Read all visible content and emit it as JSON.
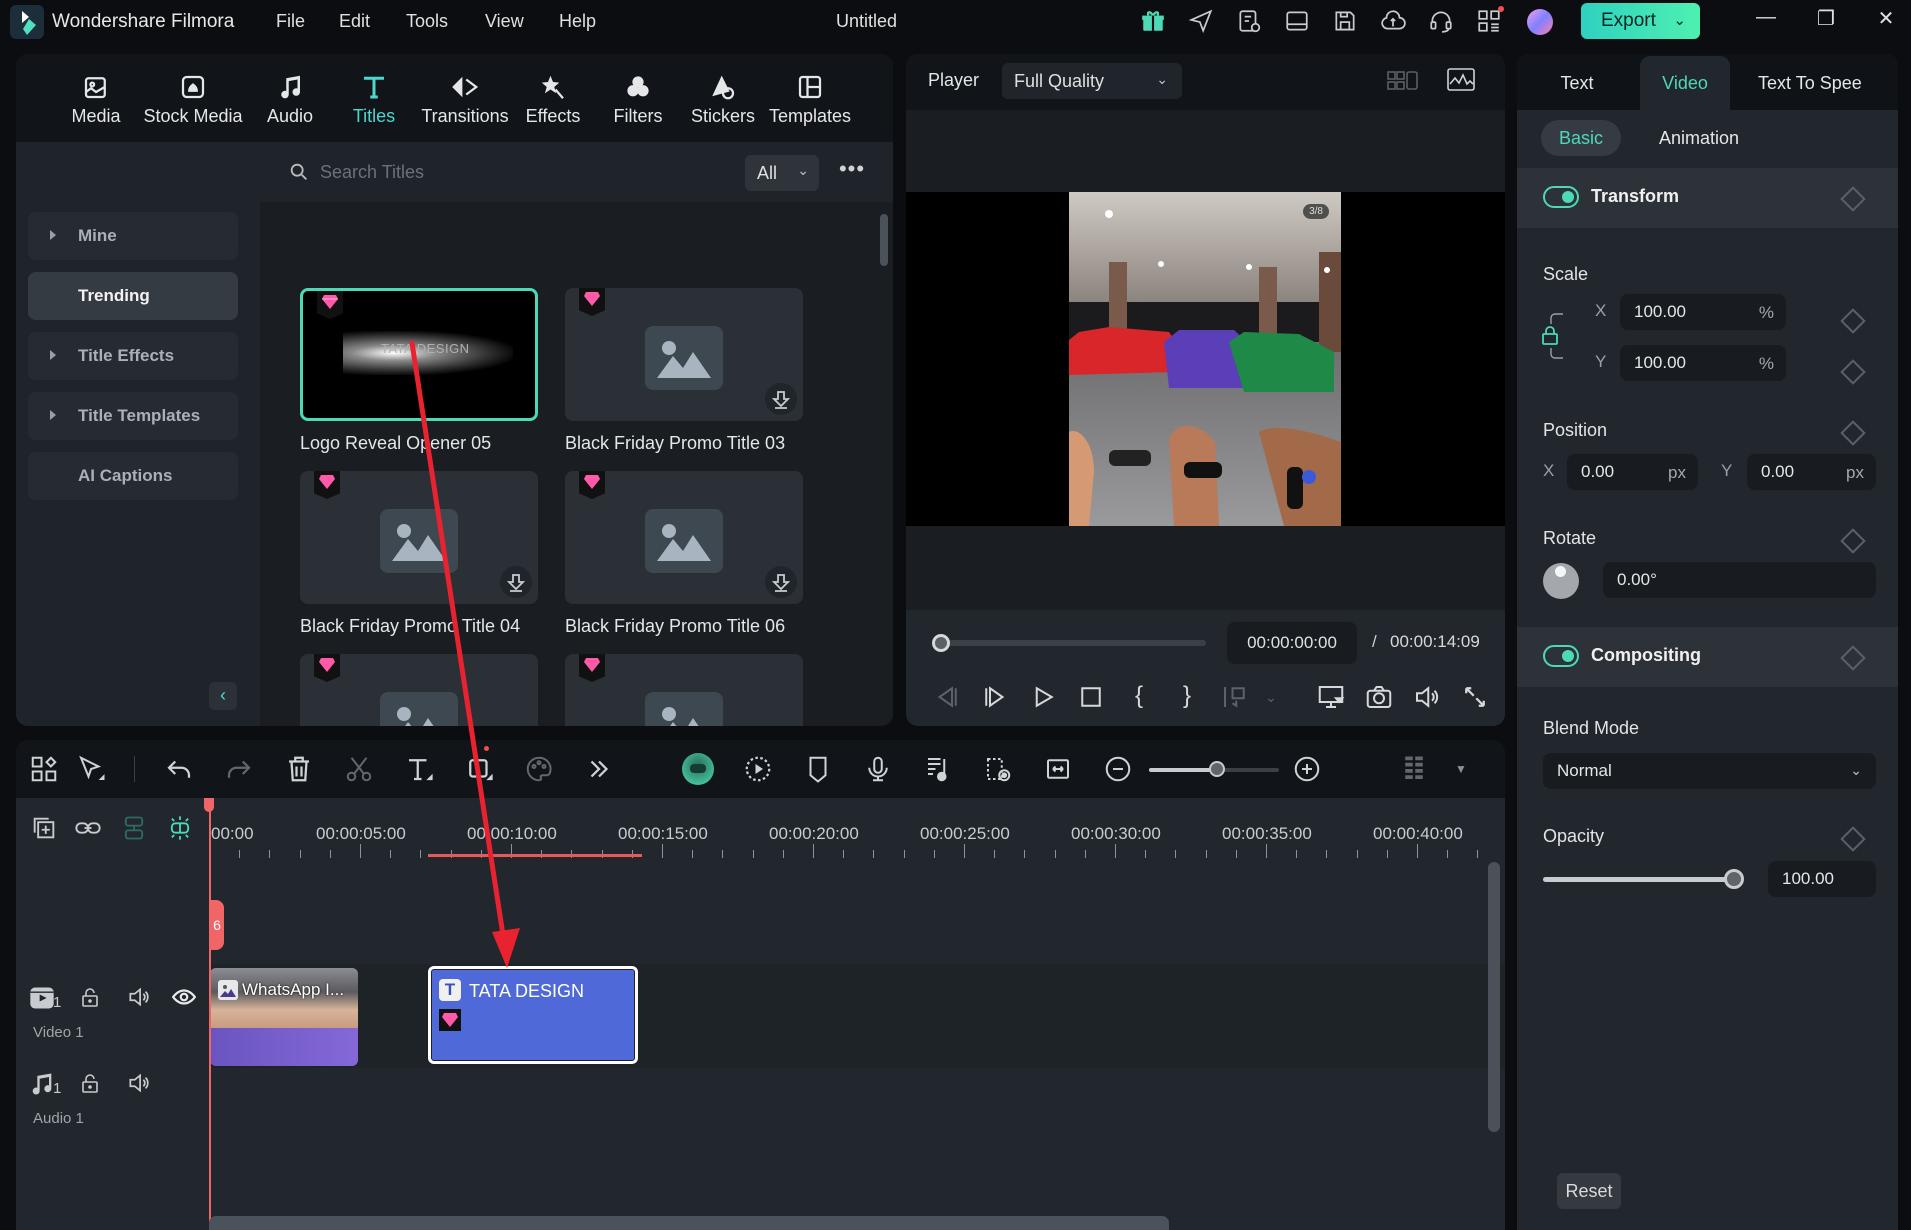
{
  "app": {
    "name": "Wondershare Filmora",
    "document_title": "Untitled",
    "menu": [
      "File",
      "Edit",
      "Tools",
      "View",
      "Help"
    ],
    "toolbar_icons": [
      "gift-icon",
      "send-icon",
      "task-list-icon",
      "layout-icon",
      "save-icon",
      "cloud-icon",
      "headset-icon",
      "apps-icon",
      "avatar"
    ],
    "export_label": "Export"
  },
  "library": {
    "tabs": [
      {
        "label": "Media",
        "icon": "media-icon"
      },
      {
        "label": "Stock Media",
        "icon": "stock-media-icon"
      },
      {
        "label": "Audio",
        "icon": "audio-icon"
      },
      {
        "label": "Titles",
        "icon": "titles-icon",
        "active": true
      },
      {
        "label": "Transitions",
        "icon": "transitions-icon"
      },
      {
        "label": "Effects",
        "icon": "effects-icon"
      },
      {
        "label": "Filters",
        "icon": "filters-icon"
      },
      {
        "label": "Stickers",
        "icon": "stickers-icon"
      },
      {
        "label": "Templates",
        "icon": "templates-icon"
      }
    ],
    "sidebar": [
      {
        "label": "Mine",
        "expandable": true
      },
      {
        "label": "Trending",
        "active": true
      },
      {
        "label": "Title Effects",
        "expandable": true
      },
      {
        "label": "Title Templates",
        "expandable": true
      },
      {
        "label": "AI Captions"
      }
    ],
    "search_placeholder": "Search Titles",
    "filter_value": "All",
    "cards": [
      {
        "name": "Logo Reveal Opener 05",
        "preview_text": "TATA DESIGN",
        "selected": true
      },
      {
        "name": "Black Friday Promo Title 03"
      },
      {
        "name": "Black Friday Promo Title 04"
      },
      {
        "name": "Black Friday Promo Title 06"
      },
      {
        "name": ""
      },
      {
        "name": ""
      }
    ]
  },
  "player": {
    "label": "Player",
    "quality": "Full Quality",
    "preview_counter": "3/8",
    "current_time": "00:00:00:00",
    "separator": "/",
    "total_time": "00:00:14:09",
    "progress": 0
  },
  "properties": {
    "tabs": [
      {
        "label": "Text"
      },
      {
        "label": "Video",
        "active": true
      },
      {
        "label": "Text To Spee"
      }
    ],
    "subtabs": [
      {
        "label": "Basic",
        "active": true
      },
      {
        "label": "Animation"
      }
    ],
    "transform": {
      "title": "Transform",
      "enabled": true,
      "scale_label": "Scale",
      "scale_x": "100.00",
      "scale_y": "100.00",
      "scale_unit": "%",
      "position_label": "Position",
      "pos_x": "0.00",
      "pos_y": "0.00",
      "pos_unit": "px",
      "rotate_label": "Rotate",
      "rotate": "0.00°",
      "axis_x": "X",
      "axis_y": "Y"
    },
    "compositing": {
      "title": "Compositing",
      "enabled": true,
      "blend_label": "Blend Mode",
      "blend_value": "Normal",
      "opacity_label": "Opacity",
      "opacity_value": "100.00",
      "opacity_fraction": 1.0
    },
    "reset_label": "Reset"
  },
  "timeline": {
    "ruler_labels": [
      "00:00",
      "00:00:05:00",
      "00:00:10:00",
      "00:00:15:00",
      "00:00:20:00",
      "00:00:25:00",
      "00:00:30:00",
      "00:00:35:00",
      "00:00:40:00"
    ],
    "zoom_level": 0.5,
    "tracks": [
      {
        "label": "Video 1",
        "index": "1"
      },
      {
        "label": "Audio 1",
        "index": "1"
      }
    ],
    "clips": {
      "video": "WhatsApp I...",
      "title": "TATA DESIGN"
    },
    "playhead_tag": "6"
  },
  "colors": {
    "accent": "#4dd8b6",
    "title_clip": "#4f6ad8",
    "playhead": "#f06666",
    "annotation_arrow": "#e8222e"
  }
}
